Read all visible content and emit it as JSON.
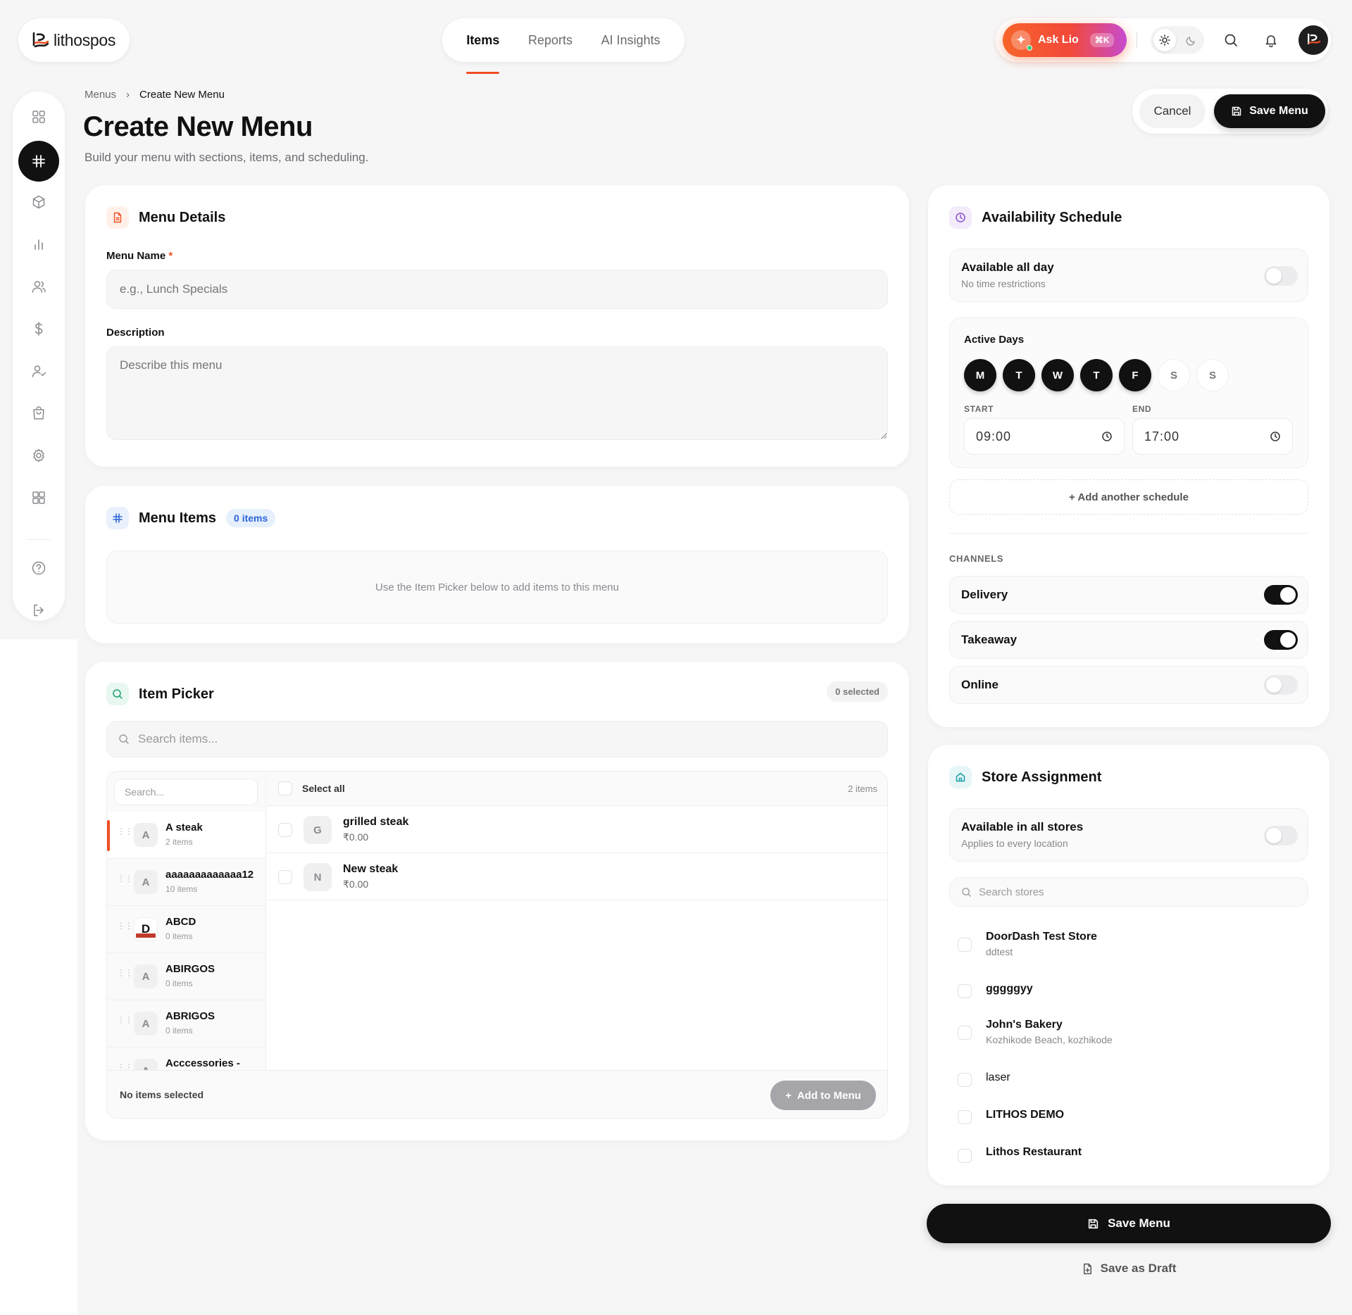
{
  "app": {
    "logo_text": "lithospos"
  },
  "nav": {
    "tabs": [
      {
        "label": "Items"
      },
      {
        "label": "Reports"
      },
      {
        "label": "AI Insights"
      }
    ]
  },
  "topbar": {
    "ask_label": "Ask Lio",
    "ask_shortcut": "⌘K"
  },
  "breadcrumb": {
    "root": "Menus",
    "separator": "›",
    "current": "Create New Menu"
  },
  "page": {
    "title": "Create New Menu",
    "subtitle": "Build your menu with sections, items, and scheduling."
  },
  "actions": {
    "cancel": "Cancel",
    "save": "Save Menu"
  },
  "menu_details": {
    "title": "Menu Details",
    "name_label": "Menu Name",
    "required_mark": "*",
    "name_placeholder": "e.g., Lunch Specials",
    "description_label": "Description",
    "description_placeholder": "Describe this menu"
  },
  "menu_items": {
    "title": "Menu Items",
    "badge": "0 items",
    "empty_text": "Use the Item Picker below to add items to this menu"
  },
  "item_picker": {
    "title": "Item Picker",
    "selected_badge": "0 selected",
    "search_placeholder": "Search items...",
    "category_search_placeholder": "Search...",
    "select_all": "Select all",
    "items_count": "2 items",
    "categories": [
      {
        "initial": "A",
        "name": "A steak",
        "count": "2 items"
      },
      {
        "initial": "A",
        "name": "aaaaaaaaaaaaa12",
        "count": "10 items"
      },
      {
        "initial": "D",
        "name": "ABCD",
        "count": "0 items"
      },
      {
        "initial": "A",
        "name": "ABIRGOS",
        "count": "0 items"
      },
      {
        "initial": "A",
        "name": "ABRIGOS",
        "count": "0 items"
      },
      {
        "initial": "A",
        "name": "Acccessories -",
        "count": ""
      }
    ],
    "items": [
      {
        "initial": "G",
        "name": "grilled steak",
        "price": "₹0.00"
      },
      {
        "initial": "N",
        "name": "New steak",
        "price": "₹0.00"
      }
    ],
    "footer_status": "No items selected",
    "add_button": "Add to Menu"
  },
  "availability": {
    "title": "Availability Schedule",
    "all_day_title": "Available all day",
    "all_day_sub": "No time restrictions",
    "all_day_on": false,
    "active_days_label": "Active Days",
    "days": [
      {
        "label": "M",
        "on": true
      },
      {
        "label": "T",
        "on": true
      },
      {
        "label": "W",
        "on": true
      },
      {
        "label": "T",
        "on": true
      },
      {
        "label": "F",
        "on": true
      },
      {
        "label": "S",
        "on": false
      },
      {
        "label": "S",
        "on": false
      }
    ],
    "start_label": "START",
    "start_value": "09:00",
    "end_label": "END",
    "end_value": "17:00",
    "add_schedule": "+ Add another schedule",
    "channels_label": "CHANNELS",
    "channels": [
      {
        "name": "Delivery",
        "on": true
      },
      {
        "name": "Takeaway",
        "on": true
      },
      {
        "name": "Online",
        "on": false
      }
    ]
  },
  "store_assignment": {
    "title": "Store Assignment",
    "all_stores_title": "Available in all stores",
    "all_stores_sub": "Applies to every location",
    "all_stores_on": false,
    "search_placeholder": "Search stores",
    "stores": [
      {
        "name": "DoorDash Test Store",
        "sub": "ddtest"
      },
      {
        "name": "gggggyy",
        "sub": ""
      },
      {
        "name": "John's Bakery",
        "sub": "Kozhikode Beach, kozhikode"
      },
      {
        "name": "laser",
        "sub": ""
      },
      {
        "name": "LITHOS DEMO",
        "sub": ""
      },
      {
        "name": "Lithos Restaurant",
        "sub": ""
      }
    ]
  },
  "footer": {
    "save": "Save Menu",
    "draft": "Save as Draft"
  },
  "colors": {
    "accent": "#f04e23",
    "dark": "#111111",
    "blue": "#2b66d6"
  }
}
